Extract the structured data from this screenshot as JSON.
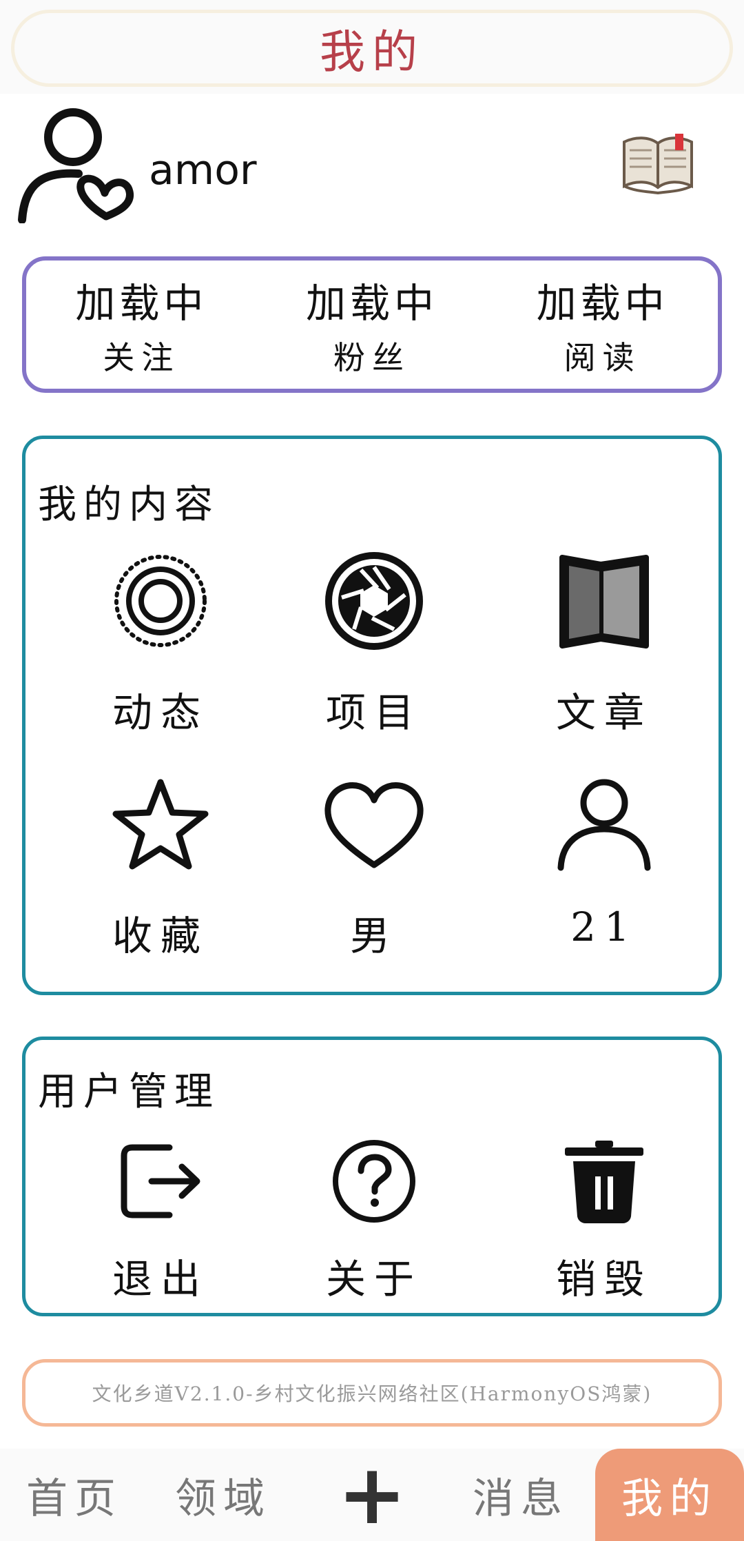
{
  "header": {
    "title": "我的"
  },
  "profile": {
    "username": "amor",
    "avatar_icon": "user-heart-icon",
    "book_icon": "open-book-icon"
  },
  "stats": [
    {
      "value": "加载中",
      "label": "关注"
    },
    {
      "value": "加载中",
      "label": "粉丝"
    },
    {
      "value": "加载中",
      "label": "阅读"
    }
  ],
  "content": {
    "title": "我的内容",
    "items": [
      {
        "label": "动态",
        "icon": "live-photo-icon"
      },
      {
        "label": "项目",
        "icon": "aperture-icon"
      },
      {
        "label": "文章",
        "icon": "folded-map-icon"
      },
      {
        "label": "收藏",
        "icon": "star-icon"
      },
      {
        "label": "男",
        "icon": "heart-icon"
      },
      {
        "label": "21",
        "icon": "person-icon"
      }
    ]
  },
  "user_management": {
    "title": "用户管理",
    "items": [
      {
        "label": "退出",
        "icon": "logout-icon"
      },
      {
        "label": "关于",
        "icon": "help-icon"
      },
      {
        "label": "销毁",
        "icon": "trash-icon"
      }
    ]
  },
  "footer": {
    "note": "文化乡道V2.1.0-乡村文化振兴网络社区(HarmonyOS鸿蒙)"
  },
  "nav": {
    "items": [
      "首页",
      "领域",
      "+",
      "消息",
      "我的"
    ],
    "active": "我的",
    "active_color": "#ee9b78"
  },
  "colors": {
    "header_title": "#b7404a",
    "stats_border": "#8474c8",
    "card_border": "#1e8ca0",
    "footer_border": "#f5b896"
  }
}
